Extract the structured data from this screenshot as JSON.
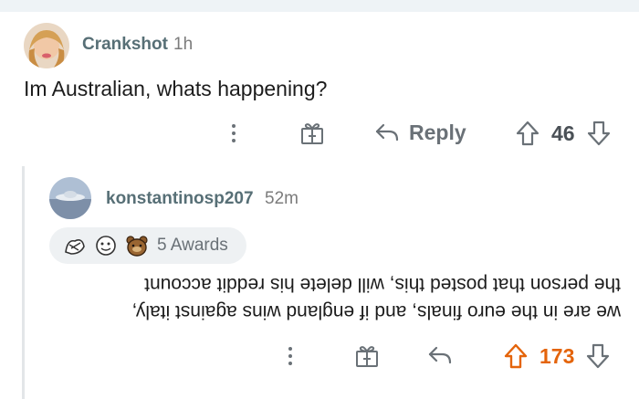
{
  "comment1": {
    "username": "Crankshot",
    "time": "1h",
    "body": "Im Australian, whats happening?",
    "reply_label": "Reply",
    "score": "46"
  },
  "comment2": {
    "username": "konstantinosp207",
    "time": "52m",
    "awards_label": "5 Awards",
    "body_lines": [
      "we are in the euro finals, and if england wins against italy,",
      "the person that posted this, will delete his reddit account"
    ],
    "score": "173"
  },
  "colors": {
    "upvote_active": "#e4640b",
    "meta_text": "#7c7c7c",
    "icon_gray": "#6a7177"
  },
  "icons": [
    "more-options-icon",
    "gift-award-icon",
    "reply-arrow-icon",
    "upvote-icon",
    "downvote-icon"
  ]
}
